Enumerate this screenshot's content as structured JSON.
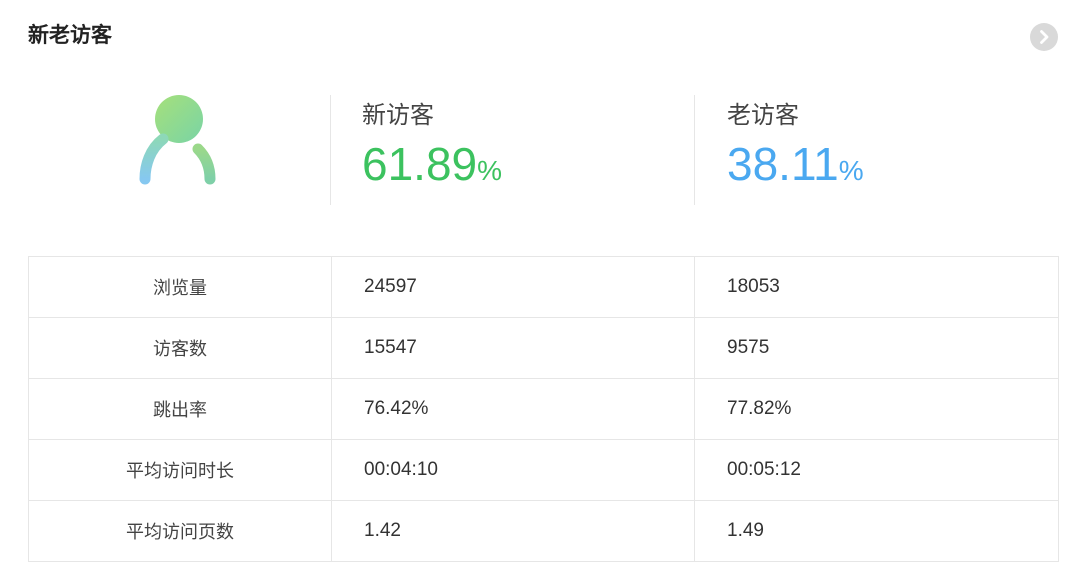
{
  "panel": {
    "title": "新老访客"
  },
  "colors": {
    "new_visitor": "#3cc25f",
    "old_visitor": "#4aa8f0"
  },
  "icons": {
    "more": "chevron-right-circle",
    "avatar": "person-gradient"
  },
  "summary": {
    "new": {
      "label": "新访客",
      "value": "61.89",
      "unit": "%"
    },
    "old": {
      "label": "老访客",
      "value": "38.11",
      "unit": "%"
    }
  },
  "table": {
    "rows": [
      {
        "name": "浏览量",
        "new": "24597",
        "old": "18053"
      },
      {
        "name": "访客数",
        "new": "15547",
        "old": "9575"
      },
      {
        "name": "跳出率",
        "new": "76.42%",
        "old": "77.82%"
      },
      {
        "name": "平均访问时长",
        "new": "00:04:10",
        "old": "00:05:12"
      },
      {
        "name": "平均访问页数",
        "new": "1.42",
        "old": "1.49"
      }
    ]
  }
}
